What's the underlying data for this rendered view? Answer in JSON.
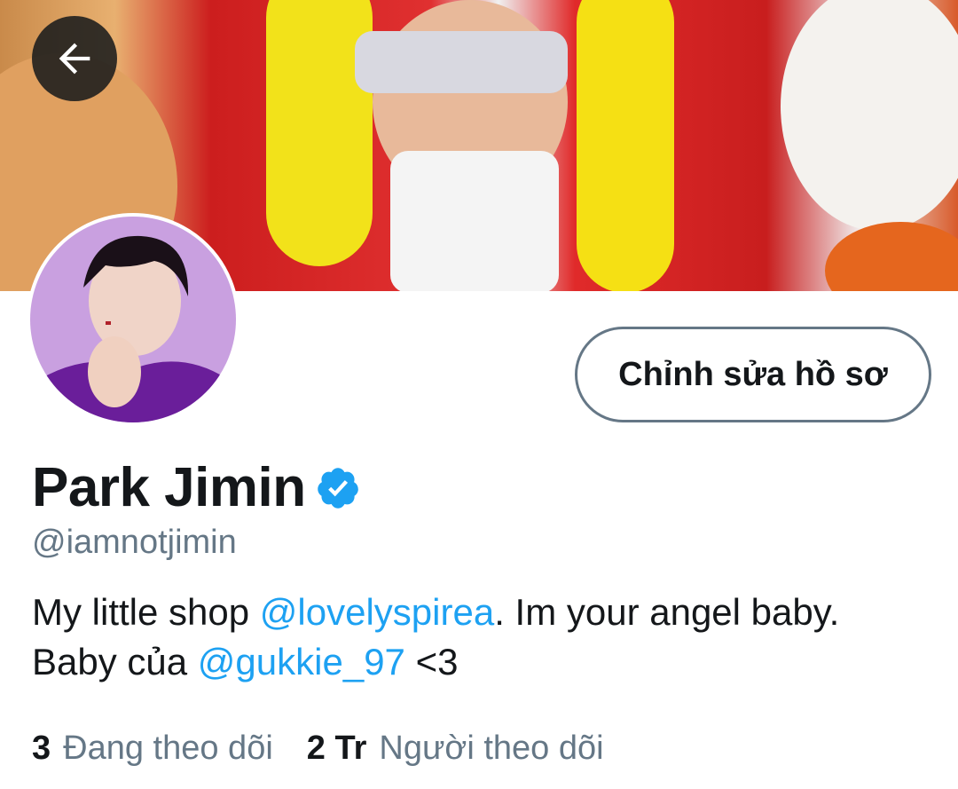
{
  "profile": {
    "edit_button_label": "Chỉnh sửa hồ sơ",
    "name": "Park Jimin",
    "handle": "@iamnotjimin",
    "bio": {
      "part1": "My little shop ",
      "mention1": "@lovelyspirea",
      "part2": ". Im your angel baby. Baby của ",
      "mention2": "@gukkie_97",
      "part3": " <3"
    },
    "stats": {
      "following_count": "3",
      "following_label": "Đang theo dõi",
      "followers_count": "2 Tr",
      "followers_label": "Người theo dõi"
    }
  },
  "colors": {
    "accent": "#1da1f2",
    "text_primary": "#14171a",
    "text_secondary": "#657786"
  },
  "icons": {
    "back": "arrow-left-icon",
    "verified": "verified-badge-icon"
  }
}
